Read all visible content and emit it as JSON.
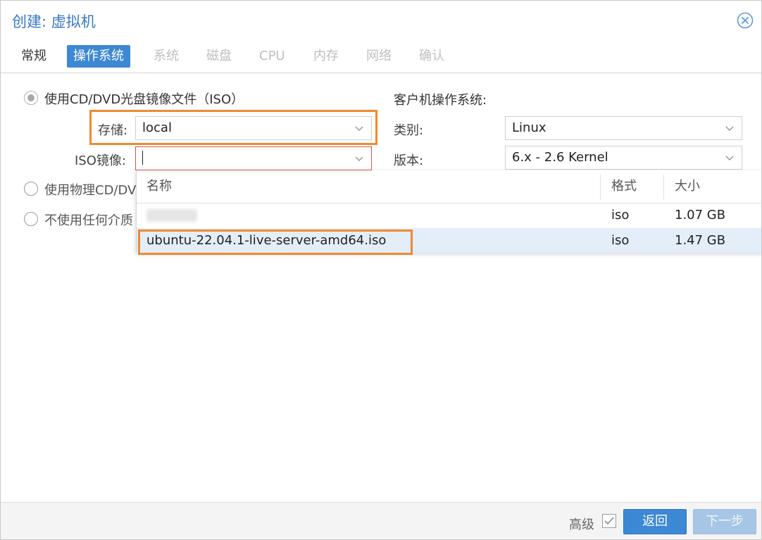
{
  "dialog": {
    "title": "创建: 虚拟机"
  },
  "tabs": [
    {
      "label": "常规",
      "state": "normal"
    },
    {
      "label": "操作系统",
      "state": "active"
    },
    {
      "label": "系统",
      "state": "disabled"
    },
    {
      "label": "磁盘",
      "state": "disabled"
    },
    {
      "label": "CPU",
      "state": "disabled"
    },
    {
      "label": "内存",
      "state": "disabled"
    },
    {
      "label": "网络",
      "state": "disabled"
    },
    {
      "label": "确认",
      "state": "disabled"
    }
  ],
  "media": {
    "option_iso": "使用CD/DVD光盘镜像文件（ISO）",
    "option_physical": "使用物理CD/DV",
    "option_none": "不使用任何介质",
    "storage_label": "存储:",
    "storage_value": "local",
    "iso_label": "ISO镜像:",
    "iso_value": ""
  },
  "guest_os": {
    "title": "客户机操作系统:",
    "type_label": "类别:",
    "type_value": "Linux",
    "version_label": "版本:",
    "version_value": "6.x - 2.6 Kernel"
  },
  "iso_dropdown": {
    "headers": {
      "name": "名称",
      "format": "格式",
      "size": "大小"
    },
    "rows": [
      {
        "name": "",
        "format": "iso",
        "size": "1.07 GB"
      },
      {
        "name": "ubuntu-22.04.1-live-server-amd64.iso",
        "format": "iso",
        "size": "1.47 GB"
      }
    ]
  },
  "footer": {
    "advanced_label": "高级",
    "back_label": "返回",
    "next_label": "下一步"
  },
  "colors": {
    "accent": "#3d88d4",
    "highlight": "#f08a2e",
    "title": "#3a78bf",
    "disabled_button": "#a7c6e6"
  }
}
